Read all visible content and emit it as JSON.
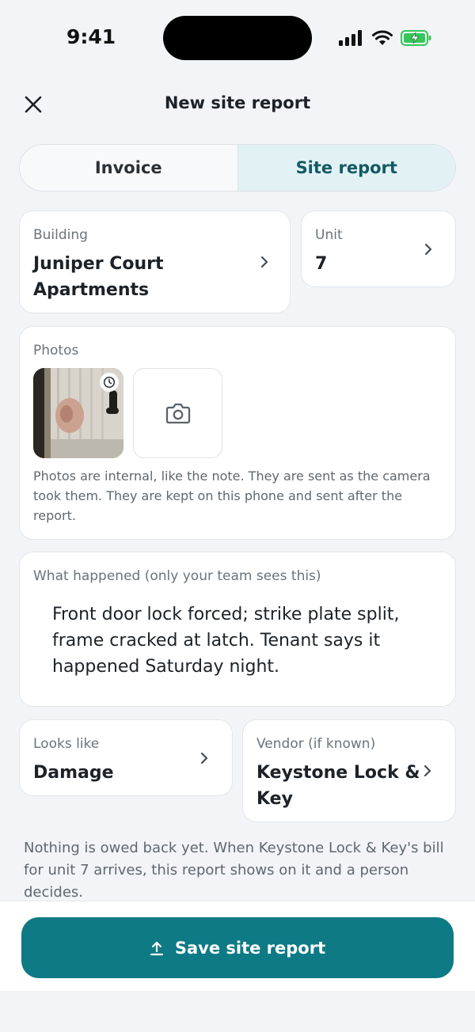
{
  "status": {
    "time": "9:41"
  },
  "header": {
    "title": "New site report"
  },
  "tabs": [
    {
      "label": "Invoice",
      "active": false
    },
    {
      "label": "Site report",
      "active": true
    }
  ],
  "building": {
    "label": "Building",
    "value": "Juniper Court Apartments"
  },
  "unit": {
    "label": "Unit",
    "value": "7"
  },
  "photos": {
    "label": "Photos",
    "note": "Photos are internal, like the note. They are sent as the camera took them. They are kept on this phone and sent after the report."
  },
  "what_happened": {
    "label": "What happened (only your team sees this)",
    "text": "Front door lock forced; strike plate split, frame cracked at latch. Tenant says it happened Saturday night."
  },
  "looks_like": {
    "label": "Looks like",
    "value": "Damage"
  },
  "vendor": {
    "label": "Vendor (if known)",
    "value": "Keystone Lock & Key"
  },
  "footer_note": "Nothing is owed back yet. When Keystone Lock & Key's bill for unit 7 arrives, this report shows on it and a person decides.",
  "save_button": {
    "label": "Save site report"
  },
  "colors": {
    "accent": "#0d7a86",
    "active_tab_bg": "#e2f2f4",
    "battery": "#34c759"
  },
  "icons": [
    "close-icon",
    "chevron-right-icon",
    "camera-icon",
    "clock-icon",
    "upload-icon",
    "signal-icon",
    "wifi-icon",
    "battery-icon"
  ]
}
